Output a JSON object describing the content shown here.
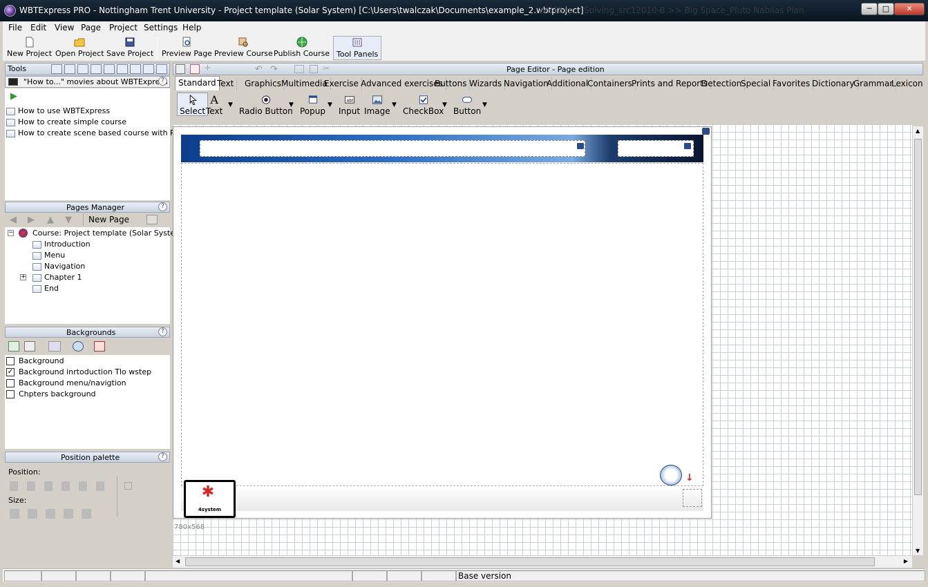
{
  "window": {
    "title": "WBTExpress PRO - Nottingham Trent University - Project template (Solar System) [C:\\Users\\twalczak\\Documents\\example_2.wbtproject]",
    "ghost_title": "WBTExp... Solving_src12010-B  >>  Big Space_Pluto   Nabilas Plan",
    "min": "─",
    "max": "□",
    "close": "✕"
  },
  "menu": [
    "File",
    "Edit",
    "View",
    "Page",
    "Project",
    "Settings",
    "Help"
  ],
  "toolbar": {
    "new_project": "New Project",
    "open_project": "Open Project",
    "save_project": "Save Project",
    "preview_page": "Preview Page",
    "preview_course": "Preview Course",
    "publish_course": "Publish Course",
    "tool_panels": "Tool Panels"
  },
  "tools": {
    "header": "Tools",
    "movies_header": "\"How to...\" movies about WBTExpress",
    "help": "?",
    "play": "▶",
    "items": [
      "How to use WBTExpress",
      "How to create simple course",
      "How to create scene based course with RPL"
    ]
  },
  "pages_manager": {
    "header": "Pages Manager",
    "help": "?",
    "new_page": "New Page",
    "course": "Course: Project template (Solar System)",
    "pages": [
      "Introduction",
      "Menu",
      "Navigation",
      "Chapter 1",
      "End"
    ],
    "collapse": "−",
    "expand": "+"
  },
  "backgrounds": {
    "header": "Backgrounds",
    "help": "?",
    "check": "✓",
    "items": [
      {
        "label": "Background",
        "checked": false
      },
      {
        "label": "Background inrtoduction Tlo wstep",
        "checked": true
      },
      {
        "label": "Background menu/navigtion",
        "checked": false
      },
      {
        "label": "Chpters background",
        "checked": false
      }
    ]
  },
  "position_palette": {
    "header": "Position palette",
    "help": "?",
    "position_label": "Position:",
    "size_label": "Size:"
  },
  "editor": {
    "header": "Page Editor - Page edition",
    "tabs": [
      "Standard",
      "Text",
      "Graphics",
      "Multimedia",
      "Exercise",
      "Advanced exercises",
      "Buttons",
      "Wizards",
      "Navigation",
      "Additional",
      "Containers",
      "Prints and Reports",
      "Detection",
      "Special",
      "Favorites",
      "Dictionary",
      "Grammar",
      "Lexicon"
    ],
    "controls": [
      "Select",
      "Text",
      "Radio Button",
      "Popup",
      "Input",
      "Image",
      "CheckBox",
      "Button"
    ],
    "dropdown_arrow": "▼",
    "page_size": "780x568",
    "logo_text": "4system"
  },
  "status": {
    "base_version": "Base version"
  }
}
